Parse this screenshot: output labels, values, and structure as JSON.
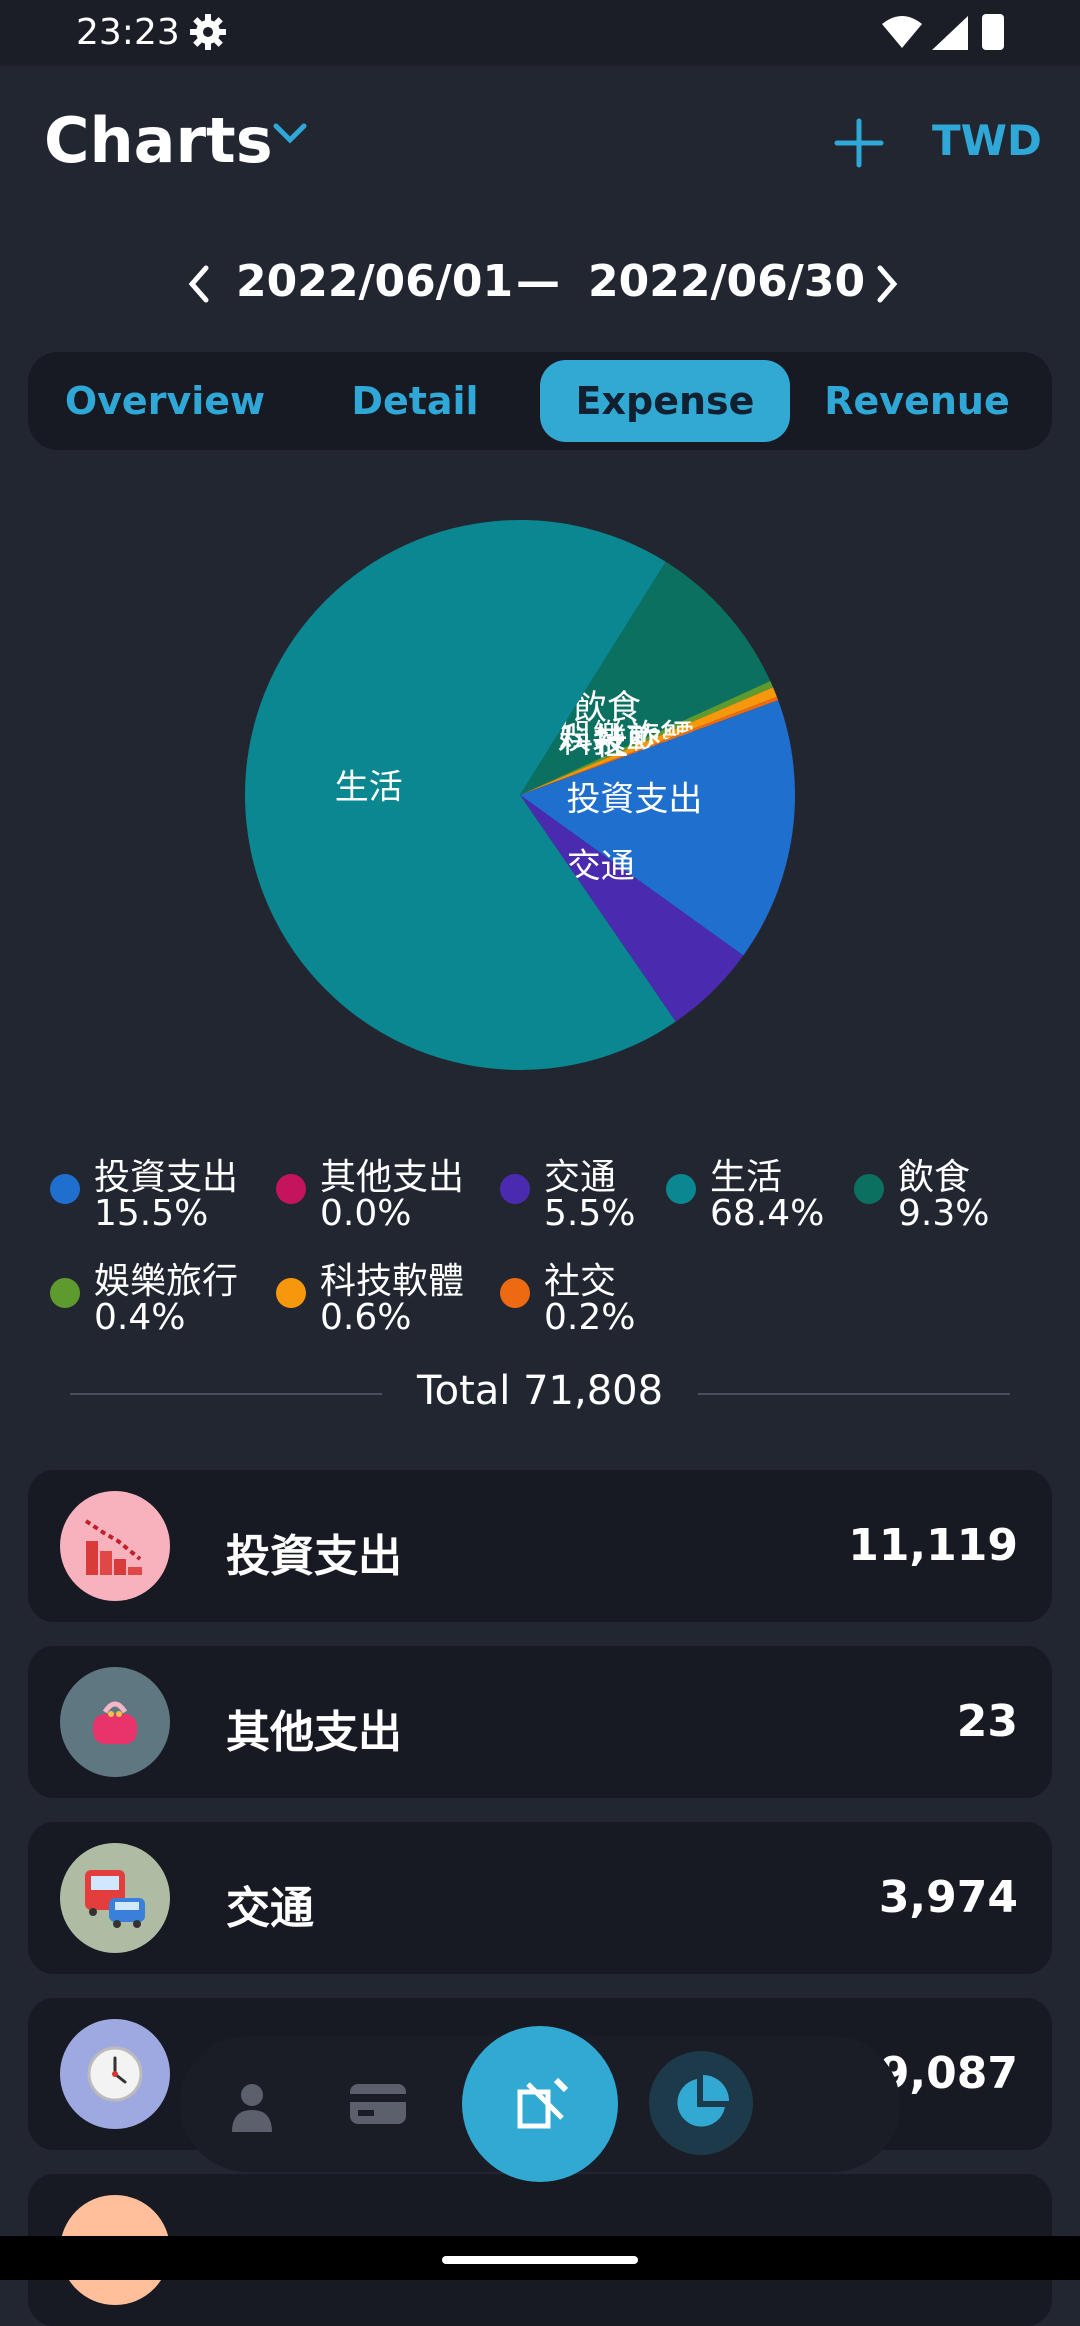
{
  "status_bar": {
    "time": "23:23"
  },
  "header": {
    "title": "Charts",
    "currency": "TWD"
  },
  "date_range": {
    "start": "2022/06/01",
    "separator": "—",
    "end": "2022/06/30"
  },
  "tabs": [
    {
      "label": "Overview",
      "active": false
    },
    {
      "label": "Detail",
      "active": false
    },
    {
      "label": "Expense",
      "active": true
    },
    {
      "label": "Revenue",
      "active": false
    }
  ],
  "chart_data": {
    "type": "pie",
    "slices": [
      {
        "label": "投資支出",
        "percent": 15.5,
        "color": "#1f6fcf"
      },
      {
        "label": "其他支出",
        "percent": 0.0,
        "color": "#c4145e"
      },
      {
        "label": "交通",
        "percent": 5.5,
        "color": "#4a2bb0"
      },
      {
        "label": "生活",
        "percent": 68.4,
        "color": "#0a8790"
      },
      {
        "label": "飲食",
        "percent": 9.3,
        "color": "#0b7060"
      },
      {
        "label": "娛樂旅行",
        "percent": 0.4,
        "color": "#5e9b2f"
      },
      {
        "label": "科技軟體",
        "percent": 0.6,
        "color": "#f7980c"
      },
      {
        "label": "社交",
        "percent": 0.2,
        "color": "#ee6a12"
      }
    ]
  },
  "legend": [
    {
      "label": "投資支出",
      "percent": "15.5%",
      "color": "#1f6fcf"
    },
    {
      "label": "其他支出",
      "percent": "0.0%",
      "color": "#c4145e"
    },
    {
      "label": "交通",
      "percent": "5.5%",
      "color": "#4a2bb0"
    },
    {
      "label": "生活",
      "percent": "68.4%",
      "color": "#0a8790"
    },
    {
      "label": "飲食",
      "percent": "9.3%",
      "color": "#0b7060"
    },
    {
      "label": "娛樂旅行",
      "percent": "0.4%",
      "color": "#5e9b2f"
    },
    {
      "label": "科技軟體",
      "percent": "0.6%",
      "color": "#f7980c"
    },
    {
      "label": "社交",
      "percent": "0.2%",
      "color": "#ee6a12"
    }
  ],
  "total": "Total 71,808",
  "list": [
    {
      "label": "投資支出",
      "value": "11,119",
      "icon": "stock-down-icon",
      "icon_bg": "#f8b2bd"
    },
    {
      "label": "其他支出",
      "value": "23",
      "icon": "purse-icon",
      "icon_bg": "#5f7780"
    },
    {
      "label": "交通",
      "value": "3,974",
      "icon": "bus-car-icon",
      "icon_bg": "#aebca4"
    },
    {
      "label": "",
      "value": "49,087",
      "icon": "clock-icon",
      "icon_bg": "#9ea9e1"
    },
    {
      "label": "",
      "value": "",
      "icon": "drink-icon",
      "icon_bg": "#ffbf9a"
    }
  ],
  "bottom_nav": [
    {
      "icon": "person-icon"
    },
    {
      "icon": "card-icon"
    },
    {
      "icon": "add-record-icon"
    },
    {
      "icon": "pie-chart-icon"
    },
    {
      "icon": "list-icon"
    }
  ]
}
